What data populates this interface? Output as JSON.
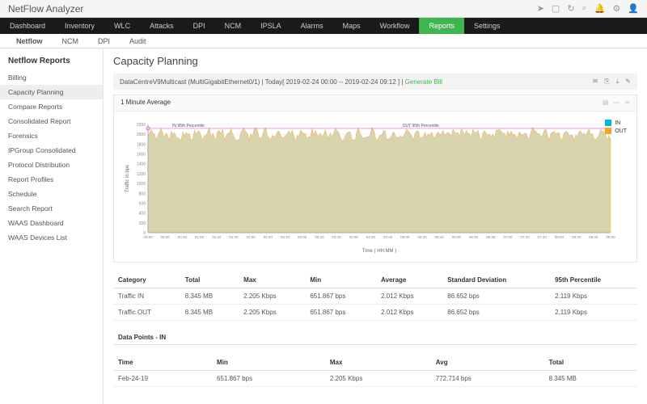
{
  "brand": "NetFlow Analyzer",
  "topicons": [
    "rocket",
    "screen",
    "refresh",
    "search",
    "bell",
    "gear",
    "user"
  ],
  "mainnav": [
    "Dashboard",
    "Inventory",
    "WLC",
    "Attacks",
    "DPI",
    "NCM",
    "IPSLA",
    "Alarms",
    "Maps",
    "Workflow",
    "Reports",
    "Settings"
  ],
  "mainnav_active": 10,
  "subnav": [
    "Netflow",
    "NCM",
    "DPI",
    "Audit"
  ],
  "subnav_active": 0,
  "sidebar_title": "Netflow Reports",
  "sidebar": [
    "Billing",
    "Capacity Planning",
    "Compare Reports",
    "Consolidated Report",
    "Forensics",
    "IPGroup Consolidated",
    "Protocol Distribution",
    "Report Profiles",
    "Schedule",
    "Search Report",
    "WAAS Dashboard",
    "WAAS Devices List"
  ],
  "sidebar_active": 1,
  "page_title": "Capacity Planning",
  "filter_text": "DataCentreV9Multicast (MultiGigabitEthernet0/1)  |  Today[ 2019-02-24 00:00 -- 2019-02-24 09:12 ]  |  ",
  "generate_label": "Generate Bill",
  "chart_title": "1 Minute Average",
  "legend": {
    "in": "IN",
    "out": "OUT"
  },
  "colors": {
    "in": "#00b8d4",
    "out": "#f5a623",
    "area": "#d4d0a8",
    "grid": "#e8e8e8",
    "percentile": "#d36ac2"
  },
  "chart_data": {
    "type": "area",
    "title": "1 Minute Average",
    "xlabel": "Time ( HH:MM )",
    "ylabel": "Traffic in bps",
    "ylim": [
      0,
      2200
    ],
    "yticks": [
      0,
      200,
      400,
      600,
      800,
      1000,
      1200,
      1400,
      1600,
      1800,
      2000,
      2200
    ],
    "xticks": [
      "00:00",
      "00:20",
      "00:40",
      "01:00",
      "01:20",
      "01:40",
      "02:00",
      "02:20",
      "02:40",
      "03:00",
      "03:20",
      "03:40",
      "04:00",
      "04:20",
      "04:40",
      "05:00",
      "05:20",
      "05:40",
      "06:00",
      "06:20",
      "06:40",
      "07:00",
      "07:20",
      "07:40",
      "08:00",
      "08:20",
      "08:40",
      "09:00"
    ],
    "annotations": [
      "IN 95th Percentile",
      "OUT 95th Percentile"
    ],
    "percentile95": 2119,
    "series": [
      {
        "name": "IN",
        "approx_mean": 2012,
        "approx_min": 652,
        "approx_max": 2205
      },
      {
        "name": "OUT",
        "approx_mean": 2012,
        "approx_min": 652,
        "approx_max": 2205
      }
    ],
    "note": "Dense minute-level series ~552 points; values oscillate tightly around ~2000 bps with occasional dips; visually IN and OUT overlap."
  },
  "table1": {
    "headers": [
      "Category ",
      "Total",
      "Max",
      "Min",
      "Average",
      "Standard Deviation",
      "95th Percentile"
    ],
    "rows": [
      [
        "Traffic IN",
        "8.345 MB",
        "2.205 Kbps",
        "651.867 bps",
        "2.012 Kbps",
        "86.652 bps",
        "2.119 Kbps"
      ],
      [
        "Traffic OUT",
        "8.345 MB",
        "2.205 Kbps",
        "651.867 bps",
        "2.012 Kbps",
        "86.652 bps",
        "2.119 Kbps"
      ]
    ]
  },
  "datapoints_title": "Data Points - IN",
  "table2": {
    "headers": [
      "Time ",
      "Min",
      "Max",
      "Avg",
      "Total"
    ],
    "rows": [
      [
        "Feb-24-19",
        "651.867 bps",
        "2.205 Kbps",
        "772.714 bps",
        "8.345 MB"
      ]
    ]
  }
}
